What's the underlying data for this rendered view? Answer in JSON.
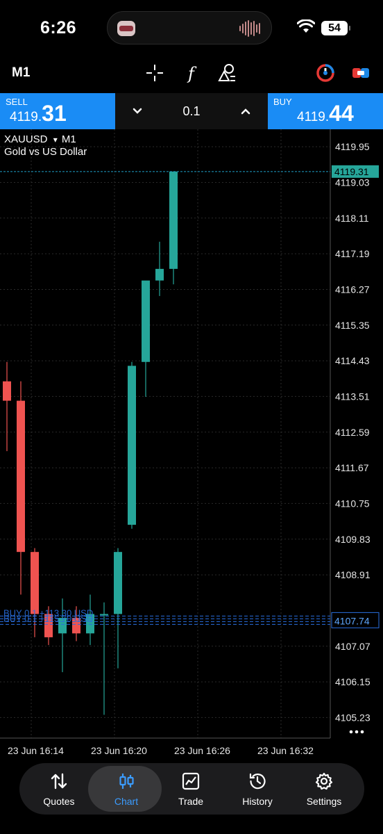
{
  "status_bar": {
    "time": "6:26",
    "battery": "54"
  },
  "toolbar": {
    "timeframe": "M1"
  },
  "trade": {
    "sell_label": "SELL",
    "sell_price_small": "4119.",
    "sell_price_big": "31",
    "buy_label": "BUY",
    "buy_price_small": "4119.",
    "buy_price_big": "44",
    "lot": "0.1"
  },
  "chart": {
    "symbol": "XAUUSD",
    "symbol_arrow": "▾",
    "timeframe": "M1",
    "description": "Gold vs US Dollar",
    "current_price_label": "4119.31",
    "position_price_label": "4107.74",
    "position_labels": [
      "BUY 0.1  +113.30 USD",
      "BUY 0.1  +115.70 USD"
    ],
    "colors": {
      "bull": "#26a69a",
      "bear": "#ef5350",
      "price_line": "#1e9ec8",
      "order_line": "#2a6fe0"
    }
  },
  "chart_data": {
    "type": "candlestick",
    "y_ticks": [
      "4119.95",
      "4119.03",
      "4118.11",
      "4117.19",
      "4116.27",
      "4115.35",
      "4114.43",
      "4113.51",
      "4112.59",
      "4111.67",
      "4110.75",
      "4109.83",
      "4108.91",
      "4107.07",
      "4106.15",
      "4105.23"
    ],
    "x_ticks": [
      "23 Jun 16:14",
      "23 Jun 16:20",
      "23 Jun 16:26",
      "23 Jun 16:32"
    ],
    "ylim": [
      4104.7,
      4120.4
    ],
    "current_price": 4119.31,
    "position_price": 4107.74,
    "candles": [
      {
        "o": 4113.9,
        "h": 4114.4,
        "l": 4112.1,
        "c": 4113.4
      },
      {
        "o": 4113.4,
        "h": 4113.9,
        "l": 4108.4,
        "c": 4109.5
      },
      {
        "o": 4109.5,
        "h": 4109.6,
        "l": 4107.3,
        "c": 4107.9
      },
      {
        "o": 4107.9,
        "h": 4108.1,
        "l": 4107.1,
        "c": 4107.3
      },
      {
        "o": 4107.4,
        "h": 4108.3,
        "l": 4106.4,
        "c": 4107.8
      },
      {
        "o": 4107.8,
        "h": 4108.1,
        "l": 4107.2,
        "c": 4107.4
      },
      {
        "o": 4107.4,
        "h": 4108.4,
        "l": 4107.1,
        "c": 4107.9
      },
      {
        "o": 4107.9,
        "h": 4108.2,
        "l": 4105.3,
        "c": 4107.9
      },
      {
        "o": 4107.9,
        "h": 4109.6,
        "l": 4106.5,
        "c": 4109.5
      },
      {
        "o": 4110.2,
        "h": 4114.4,
        "l": 4110.1,
        "c": 4114.3
      },
      {
        "o": 4114.4,
        "h": 4116.4,
        "l": 4113.5,
        "c": 4116.5
      },
      {
        "o": 4116.5,
        "h": 4117.5,
        "l": 4116.1,
        "c": 4116.8
      },
      {
        "o": 4116.8,
        "h": 4119.31,
        "l": 4116.4,
        "c": 4119.31
      }
    ]
  },
  "nav": {
    "items": [
      {
        "label": "Quotes",
        "icon": "quotes-arrows-icon"
      },
      {
        "label": "Chart",
        "icon": "candlestick-icon"
      },
      {
        "label": "Trade",
        "icon": "trade-chart-icon"
      },
      {
        "label": "History",
        "icon": "history-clock-icon"
      },
      {
        "label": "Settings",
        "icon": "gear-icon"
      }
    ],
    "active": "Chart"
  }
}
